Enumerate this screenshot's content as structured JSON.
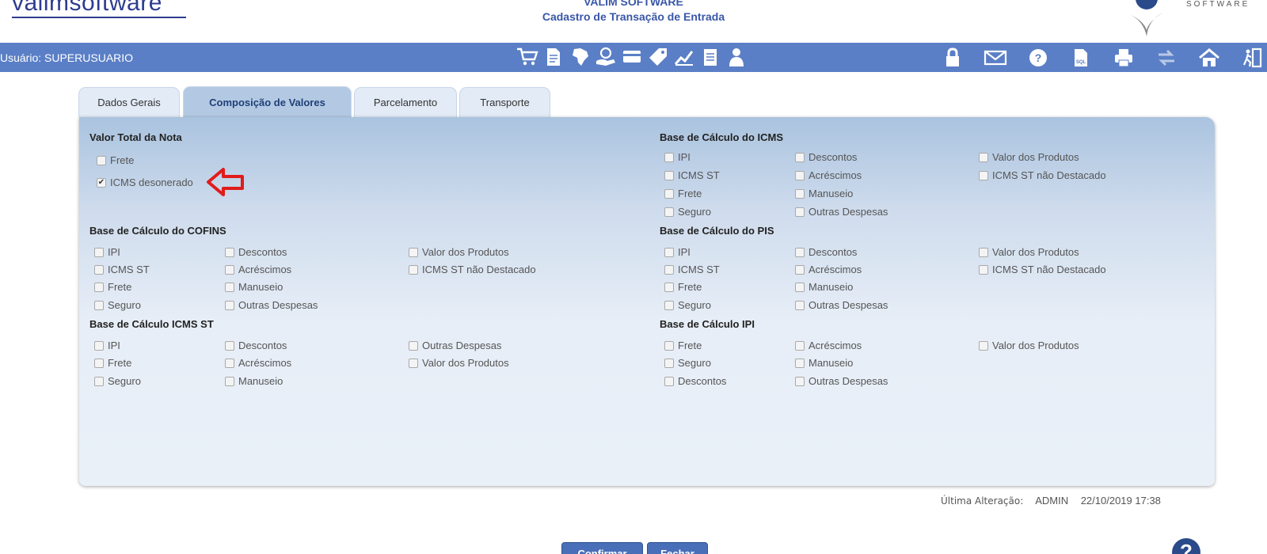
{
  "header": {
    "logo_text": "valimsoftware",
    "title": "VALIM SOFTWARE",
    "subtitle": "Cadastro de Transação de Entrada",
    "brand_text": "SOFTWARE"
  },
  "toolbar": {
    "user_label": "Usuário: SUPERUSUARIO",
    "module_icons": [
      "cart-icon",
      "document-icon",
      "map-icon",
      "money-hand-icon",
      "card-icon",
      "tag-icon",
      "chart-icon",
      "report-icon",
      "user-icon"
    ],
    "right_icons": [
      "lock-icon",
      "mail-icon",
      "help-icon",
      "sql-file-icon",
      "print-icon",
      "swap-icon",
      "home-icon",
      "exit-icon"
    ],
    "sql_text": "SQL"
  },
  "tabs": [
    {
      "label": "Dados Gerais",
      "active": false
    },
    {
      "label": "Composição de Valores",
      "active": true
    },
    {
      "label": "Parcelamento",
      "active": false
    },
    {
      "label": "Transporte",
      "active": false
    }
  ],
  "sections": {
    "valor_total": {
      "title": "Valor Total da Nota",
      "items": [
        {
          "label": "Frete",
          "checked": false
        },
        {
          "label": "ICMS desonerado",
          "checked": true
        }
      ]
    },
    "icms": {
      "title": "Base de Cálculo do ICMS",
      "items": [
        {
          "label": "IPI",
          "checked": false
        },
        {
          "label": "ICMS ST",
          "checked": false
        },
        {
          "label": "Frete",
          "checked": false
        },
        {
          "label": "Seguro",
          "checked": false
        },
        {
          "label": "Descontos",
          "checked": false
        },
        {
          "label": "Acréscimos",
          "checked": false
        },
        {
          "label": "Manuseio",
          "checked": false
        },
        {
          "label": "Outras Despesas",
          "checked": false
        },
        {
          "label": "Valor dos Produtos",
          "checked": false
        },
        {
          "label": "ICMS ST não Destacado",
          "checked": false
        }
      ]
    },
    "cofins": {
      "title": "Base de Cálculo do COFINS",
      "items": [
        {
          "label": "IPI",
          "checked": false
        },
        {
          "label": "ICMS ST",
          "checked": false
        },
        {
          "label": "Frete",
          "checked": false
        },
        {
          "label": "Seguro",
          "checked": false
        },
        {
          "label": "Descontos",
          "checked": false
        },
        {
          "label": "Acréscimos",
          "checked": false
        },
        {
          "label": "Manuseio",
          "checked": false
        },
        {
          "label": "Outras Despesas",
          "checked": false
        },
        {
          "label": "Valor dos Produtos",
          "checked": false
        },
        {
          "label": "ICMS ST não Destacado",
          "checked": false
        }
      ]
    },
    "pis": {
      "title": "Base de Cálculo do PIS",
      "items": [
        {
          "label": "IPI",
          "checked": false
        },
        {
          "label": "ICMS ST",
          "checked": false
        },
        {
          "label": "Frete",
          "checked": false
        },
        {
          "label": "Seguro",
          "checked": false
        },
        {
          "label": "Descontos",
          "checked": false
        },
        {
          "label": "Acréscimos",
          "checked": false
        },
        {
          "label": "Manuseio",
          "checked": false
        },
        {
          "label": "Outras Despesas",
          "checked": false
        },
        {
          "label": "Valor dos Produtos",
          "checked": false
        },
        {
          "label": "ICMS ST não Destacado",
          "checked": false
        }
      ]
    },
    "icms_st": {
      "title": "Base de Cálculo ICMS ST",
      "items": [
        {
          "label": "IPI",
          "checked": false
        },
        {
          "label": "Frete",
          "checked": false
        },
        {
          "label": "Seguro",
          "checked": false
        },
        {
          "label": "Descontos",
          "checked": false
        },
        {
          "label": "Acréscimos",
          "checked": false
        },
        {
          "label": "Manuseio",
          "checked": false
        },
        {
          "label": "Outras Despesas",
          "checked": false
        },
        {
          "label": "Valor dos Produtos",
          "checked": false
        }
      ]
    },
    "ipi": {
      "title": "Base de Cálculo IPI",
      "items": [
        {
          "label": "Frete",
          "checked": false
        },
        {
          "label": "Seguro",
          "checked": false
        },
        {
          "label": "Descontos",
          "checked": false
        },
        {
          "label": "Acréscimos",
          "checked": false
        },
        {
          "label": "Manuseio",
          "checked": false
        },
        {
          "label": "Outras Despesas",
          "checked": false
        },
        {
          "label": "Valor dos Produtos",
          "checked": false
        }
      ]
    }
  },
  "last_change": {
    "label": "Última Alteração:",
    "user": "ADMIN",
    "datetime": "22/10/2019 17:38"
  },
  "buttons": {
    "confirm_label": "Confirmar",
    "close_label": "Fechar",
    "help_glyph": "?"
  },
  "colors": {
    "toolbar_bg": "#5a7fc6",
    "accent": "#3a57a8",
    "arrow": "#e11b1b"
  }
}
